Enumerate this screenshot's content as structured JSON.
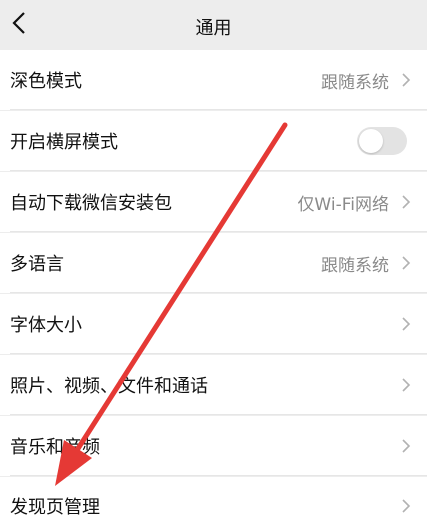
{
  "header": {
    "title": "通用"
  },
  "settings": {
    "rows": [
      {
        "label": "深色模式",
        "value": "跟随系统"
      },
      {
        "label": "开启横屏模式",
        "toggle_on": false
      },
      {
        "label": "自动下载微信安装包",
        "value": "仅Wi-Fi网络"
      },
      {
        "label": "多语言",
        "value": "跟随系统"
      },
      {
        "label": "字体大小"
      },
      {
        "label": "照片、视频、文件和通话"
      },
      {
        "label": "音乐和音频"
      },
      {
        "label": "发现页管理"
      }
    ]
  },
  "annotation": {
    "color": "#e53935"
  }
}
